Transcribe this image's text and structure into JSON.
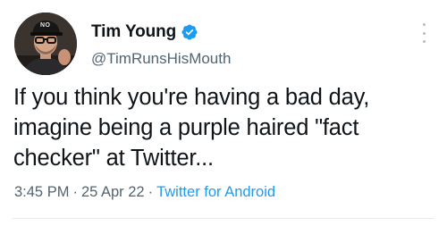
{
  "author": {
    "display_name": "Tim Young",
    "handle": "@TimRunsHisMouth",
    "avatar_cap_text": "NO",
    "verified": true
  },
  "tweet": {
    "text": "If you think you're having a bad day,\nimagine being a purple haired \"fact\nchecker\" at Twitter..."
  },
  "meta": {
    "time": "3:45 PM",
    "separator": "·",
    "date": "25 Apr 22",
    "source": "Twitter for Android"
  },
  "colors": {
    "text_primary": "#0f1419",
    "text_secondary": "#536471",
    "accent": "#1d9bf0"
  },
  "icons": {
    "verified": "verified-badge-icon",
    "more": "more-options-icon"
  }
}
